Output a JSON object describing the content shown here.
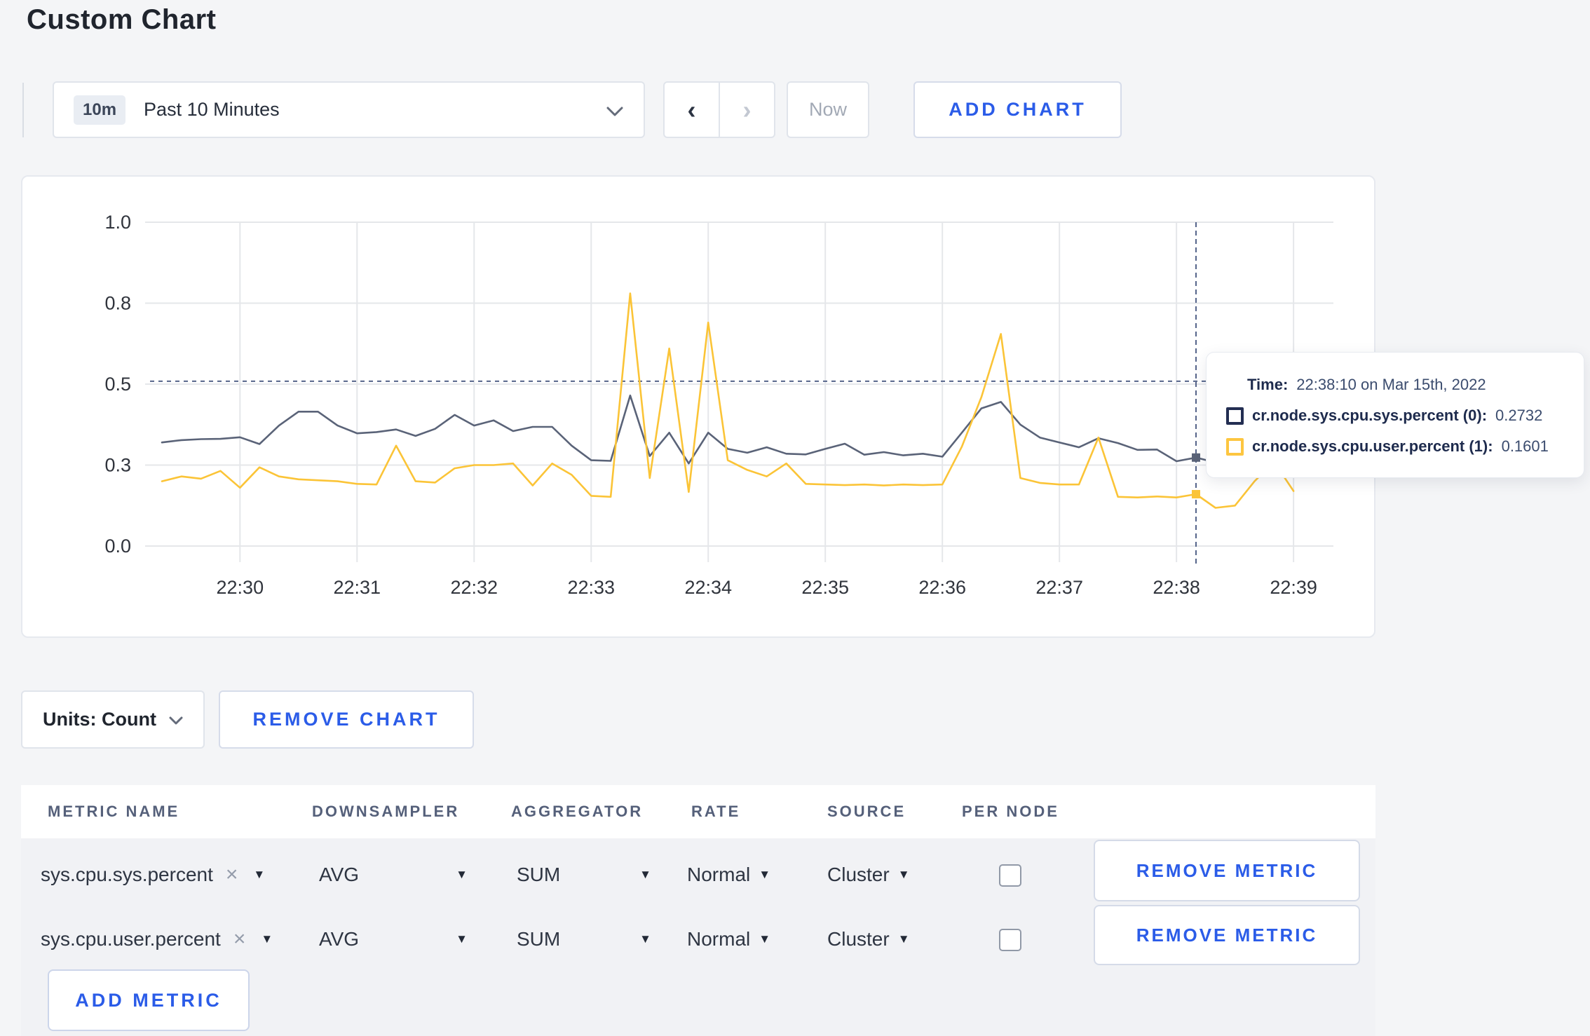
{
  "page": {
    "title": "Custom Chart",
    "accent_blue": "#2b5ce8",
    "background": "#f4f5f7"
  },
  "toolbar": {
    "time_range": {
      "badge": "10m",
      "label": "Past 10 Minutes"
    },
    "prev_label": "‹",
    "next_label": "›",
    "now_label": "Now",
    "add_chart_label": "ADD CHART"
  },
  "chart_data": {
    "type": "line",
    "title": "",
    "xlabel": "",
    "ylabel": "",
    "ylim": [
      0,
      1
    ],
    "grid": true,
    "y_tick_labels": [
      "0.0",
      "0.3",
      "0.5",
      "0.8",
      "1.0"
    ],
    "y_tick_values": [
      0,
      0.25,
      0.5,
      0.75,
      1.0
    ],
    "x_tick_labels": [
      "22:30",
      "22:31",
      "22:32",
      "22:33",
      "22:34",
      "22:35",
      "22:36",
      "22:37",
      "22:38",
      "22:39"
    ],
    "x_start": "22:29:20",
    "x_interval_seconds": 10,
    "series": [
      {
        "name": "cr.node.sys.cpu.sys.percent",
        "color": "#5a6378",
        "values": [
          0.32,
          0.327,
          0.33,
          0.331,
          0.336,
          0.315,
          0.372,
          0.415,
          0.415,
          0.372,
          0.348,
          0.352,
          0.36,
          0.34,
          0.362,
          0.405,
          0.372,
          0.388,
          0.355,
          0.368,
          0.368,
          0.31,
          0.265,
          0.263,
          0.465,
          0.278,
          0.35,
          0.255,
          0.35,
          0.3,
          0.288,
          0.305,
          0.285,
          0.283,
          0.3,
          0.316,
          0.282,
          0.29,
          0.28,
          0.285,
          0.276,
          0.35,
          0.425,
          0.445,
          0.375,
          0.335,
          0.32,
          0.305,
          0.333,
          0.318,
          0.297,
          0.298,
          0.262,
          0.2732,
          0.258,
          0.27,
          0.285,
          0.3,
          0.292
        ]
      },
      {
        "name": "cr.node.sys.cpu.user.percent",
        "color": "#fbc437",
        "values": [
          0.2,
          0.215,
          0.208,
          0.232,
          0.18,
          0.243,
          0.215,
          0.206,
          0.203,
          0.2,
          0.192,
          0.19,
          0.31,
          0.2,
          0.196,
          0.24,
          0.25,
          0.25,
          0.255,
          0.187,
          0.255,
          0.22,
          0.155,
          0.152,
          0.78,
          0.21,
          0.61,
          0.167,
          0.69,
          0.265,
          0.235,
          0.215,
          0.255,
          0.192,
          0.19,
          0.188,
          0.19,
          0.187,
          0.19,
          0.188,
          0.19,
          0.307,
          0.46,
          0.655,
          0.21,
          0.195,
          0.19,
          0.19,
          0.335,
          0.152,
          0.15,
          0.153,
          0.15,
          0.1601,
          0.118,
          0.125,
          0.2,
          0.26,
          0.17
        ]
      }
    ],
    "hover": {
      "index": 53,
      "time": "22:38:10",
      "crosshair_y_value": 0.509,
      "values": [
        0.2732,
        0.1601
      ]
    },
    "legend_position": "tooltip"
  },
  "tooltip": {
    "time_label": "Time:",
    "time_value": "22:38:10 on Mar 15th, 2022",
    "series": [
      {
        "name": "cr.node.sys.cpu.sys.percent (0):",
        "value": "0.2732",
        "color": "#232e52"
      },
      {
        "name": "cr.node.sys.cpu.user.percent (1):",
        "value": "0.1601",
        "color": "#fdc640"
      }
    ]
  },
  "below_chart": {
    "units_label": "Units: Count",
    "remove_chart_label": "REMOVE CHART"
  },
  "metrics_table": {
    "columns": [
      "METRIC NAME",
      "DOWNSAMPLER",
      "AGGREGATOR",
      "RATE",
      "SOURCE",
      "PER NODE"
    ],
    "rows": [
      {
        "metric": "sys.cpu.sys.percent",
        "downsampler": "AVG",
        "aggregator": "SUM",
        "rate": "Normal",
        "source": "Cluster",
        "per_node_checked": false
      },
      {
        "metric": "sys.cpu.user.percent",
        "downsampler": "AVG",
        "aggregator": "SUM",
        "rate": "Normal",
        "source": "Cluster",
        "per_node_checked": false
      }
    ],
    "remove_metric_label": "REMOVE METRIC",
    "add_metric_label": "ADD METRIC",
    "remove_icon": "×",
    "caret_icon": "▼"
  }
}
